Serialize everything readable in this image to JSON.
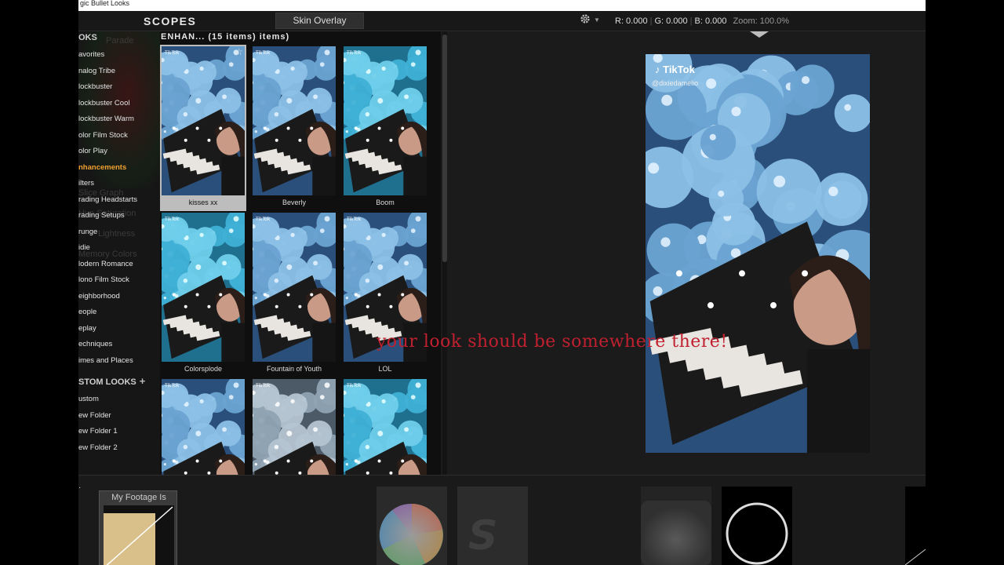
{
  "window": {
    "title": "gic Bullet Looks"
  },
  "toolbar": {
    "scopes_title": "SCOPES",
    "skin_overlay_label": "Skin Overlay",
    "gear_caret": "▼",
    "readout": {
      "r": "R: 0.000",
      "g": "G: 0.000",
      "b": "B: 0.000",
      "zoom": "Zoom: 100.0%"
    }
  },
  "sidebar": {
    "looks_header": "OKS",
    "ghost_items": [
      "Parade",
      "Slice Graph",
      "Hue Saturation",
      "Lightness",
      "Memory Colors"
    ],
    "items": [
      {
        "label": "avorites",
        "active": false
      },
      {
        "label": "nalog Tribe",
        "active": false
      },
      {
        "label": "lockbuster",
        "active": false
      },
      {
        "label": "lockbuster Cool",
        "active": false
      },
      {
        "label": "lockbuster Warm",
        "active": false
      },
      {
        "label": "olor Film Stock",
        "active": false
      },
      {
        "label": "olor Play",
        "active": false
      },
      {
        "label": "nhancements",
        "active": true
      },
      {
        "label": "ilters",
        "active": false
      },
      {
        "label": "rading Headstarts",
        "active": false
      },
      {
        "label": "rading Setups",
        "active": false
      },
      {
        "label": "runge",
        "active": false
      },
      {
        "label": "idie",
        "active": false
      },
      {
        "label": "lodern Romance",
        "active": false
      },
      {
        "label": "lono Film Stock",
        "active": false
      },
      {
        "label": "eighborhood",
        "active": false
      },
      {
        "label": "eople",
        "active": false
      },
      {
        "label": "eplay",
        "active": false
      },
      {
        "label": "echniques",
        "active": false
      },
      {
        "label": "imes and Places",
        "active": false
      }
    ],
    "custom_header": "STOM LOOKS",
    "custom_plus": "+",
    "custom_items": [
      "ustom",
      "ew Folder",
      "ew Folder 1",
      "ew Folder 2"
    ]
  },
  "grid": {
    "header": "ENHAN... (15 items) items)",
    "tiles": [
      {
        "label": "kisses xx",
        "selected": true,
        "tint": "blue"
      },
      {
        "label": "Beverly",
        "selected": false,
        "tint": "blue"
      },
      {
        "label": "Boom",
        "selected": false,
        "tint": "cyan"
      },
      {
        "label": "Colorsplode",
        "selected": false,
        "tint": "cyan"
      },
      {
        "label": "Fountain of Youth",
        "selected": false,
        "tint": "blue"
      },
      {
        "label": "LOL",
        "selected": false,
        "tint": "blue"
      },
      {
        "label": "",
        "selected": false,
        "tint": "blue"
      },
      {
        "label": "",
        "selected": false,
        "tint": "grey"
      },
      {
        "label": "",
        "selected": false,
        "tint": "cyan"
      }
    ],
    "star_icon": "☆",
    "thumb_watermark": "TikTok"
  },
  "viewer": {
    "tiktok_logo": "♪ TikTok",
    "tiktok_user": "@dixiedamelio",
    "overlay_text": "your look should be somewhere there!"
  },
  "bottom": {
    "footage_label": "My Footage Is",
    "footage_swatch_color": "#d9c08a"
  },
  "colors": {
    "accent_active": "#f0a030",
    "overlay_text": "#c0202f",
    "balloon_blue": "#5a95c6",
    "balloon_cyan": "#3fa8cf"
  }
}
